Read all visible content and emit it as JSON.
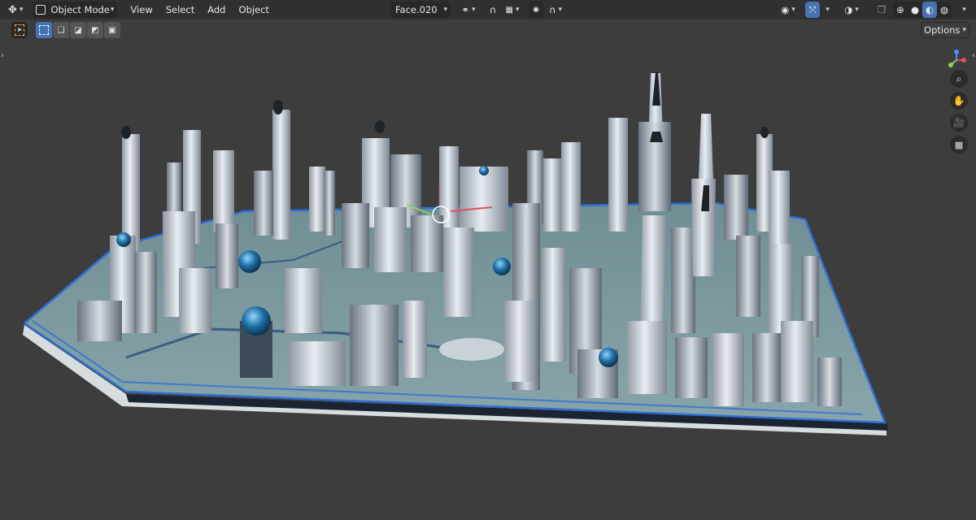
{
  "header": {
    "mode_label": "Object Mode",
    "menus": [
      "View",
      "Select",
      "Add",
      "Object"
    ],
    "active_object": "Face.020"
  },
  "toolbar": {
    "options_label": "Options"
  },
  "icons": {
    "editor_type": "transform-gizmo-icon",
    "mode": "object-mode-icon",
    "transform_orientation": "link-icon",
    "snap": "magnet-icon",
    "snap_target": "grid-snap-icon",
    "proportional": "proportional-edit-icon",
    "falloff": "falloff-curve-icon",
    "visibility": "eye-icon",
    "gizmo": "gizmo-icon",
    "overlays": "overlays-icon",
    "xray": "xray-icon",
    "shading_wire": "wireframe-shading-icon",
    "shading_solid": "solid-shading-icon",
    "shading_material": "material-shading-icon",
    "shading_render": "rendered-shading-icon",
    "select_tool": "select-cursor-icon",
    "zoom": "zoom-icon",
    "pan": "hand-icon",
    "camera": "camera-icon",
    "ortho": "grid-icon"
  },
  "colors": {
    "accent": "#4772b3",
    "viewport_bg": "#3d3d3d",
    "header_bg": "#303030"
  }
}
